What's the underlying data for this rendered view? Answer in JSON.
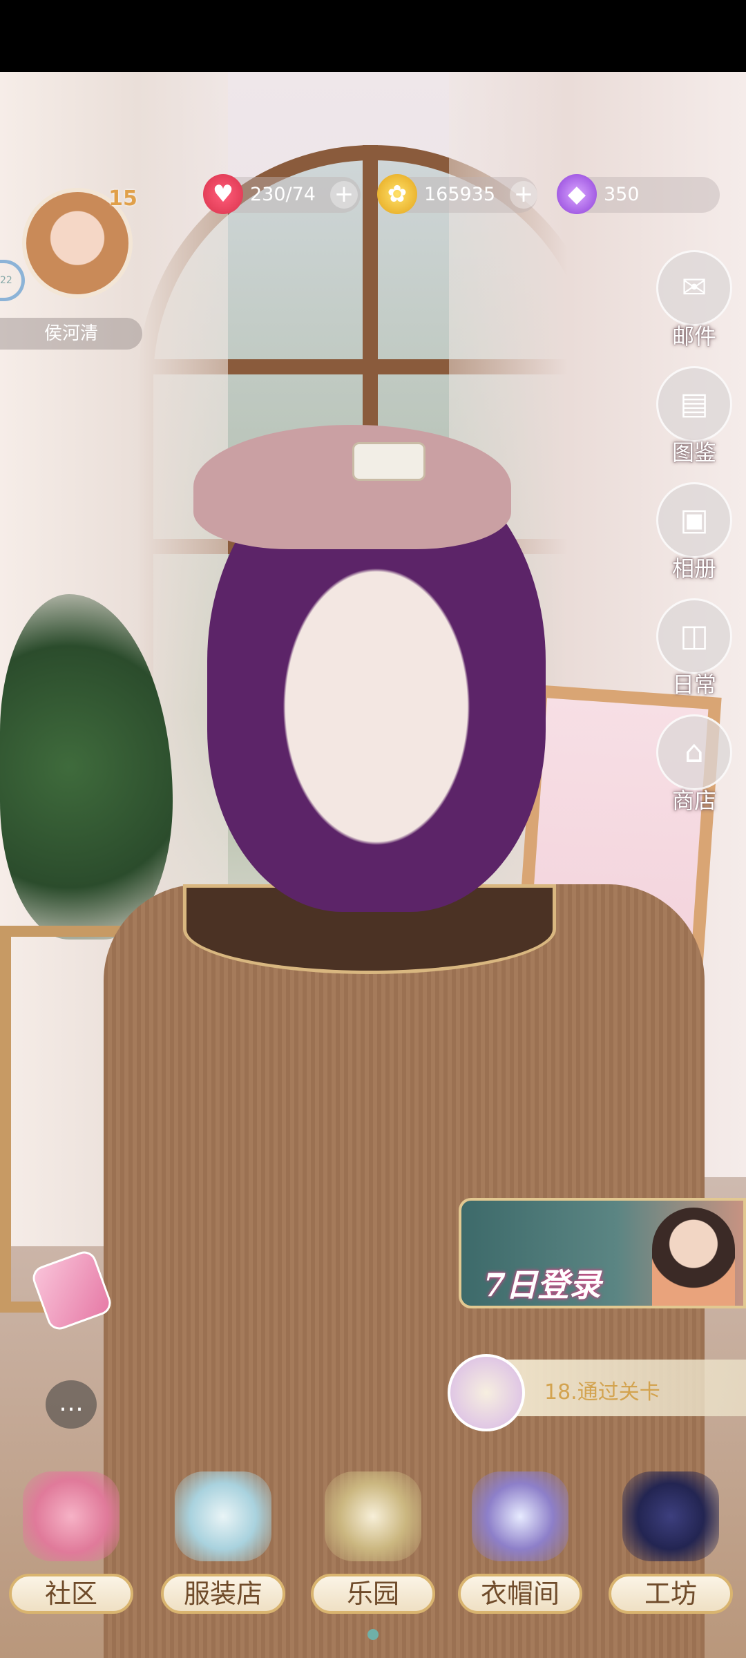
{
  "player": {
    "name": "侯河清",
    "level": "15",
    "ring_badge": "22"
  },
  "resources": [
    {
      "id": "stamina",
      "icon": "heart-icon",
      "value": "230/74",
      "has_plus": true,
      "color": "#e23b57"
    },
    {
      "id": "gold",
      "icon": "coin-icon",
      "value": "165935",
      "has_plus": true,
      "color": "#f0b62b"
    },
    {
      "id": "diamond",
      "icon": "gem-icon",
      "value": "350",
      "has_plus": false,
      "color": "#a357e6"
    }
  ],
  "side_menu": [
    {
      "id": "mail",
      "icon": "envelope-icon",
      "label": "邮件"
    },
    {
      "id": "collection",
      "icon": "album-book-icon",
      "label": "图鉴"
    },
    {
      "id": "album",
      "icon": "photo-icon",
      "label": "相册"
    },
    {
      "id": "daily",
      "icon": "calendar-icon",
      "label": "日常"
    },
    {
      "id": "shop",
      "icon": "storefront-icon",
      "label": "商店"
    }
  ],
  "banner": {
    "text": "7日登录"
  },
  "task": {
    "text": "18.通过关卡",
    "icon": "scroll-icon"
  },
  "bottom_nav": [
    {
      "id": "community",
      "label": "社区"
    },
    {
      "id": "clothing-store",
      "label": "服装店"
    },
    {
      "id": "park",
      "label": "乐园"
    },
    {
      "id": "wardrobe",
      "label": "衣帽间"
    },
    {
      "id": "workshop",
      "label": "工坊"
    }
  ],
  "glyphs": {
    "heart": "♥",
    "coin": "✿",
    "gem": "◆",
    "plus": "+",
    "mail": "✉",
    "collection": "▤",
    "album": "▣",
    "daily": "◫",
    "shop": "⌂",
    "chat": "…",
    "scroll": "📜"
  }
}
